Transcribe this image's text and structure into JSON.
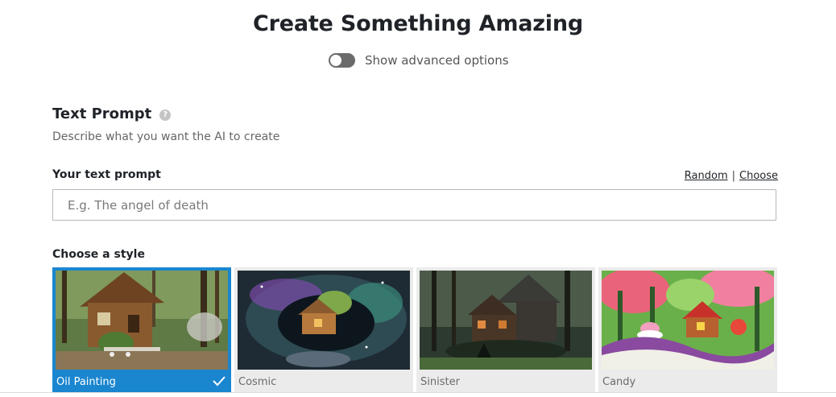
{
  "page": {
    "title": "Create Something Amazing",
    "advanced_toggle_label": "Show advanced options",
    "advanced_toggle_on": false
  },
  "text_prompt": {
    "heading": "Text Prompt",
    "help_icon": "question-icon",
    "description": "Describe what you want the AI to create",
    "field_label": "Your text prompt",
    "random_link": "Random",
    "separator": "|",
    "choose_link": "Choose",
    "placeholder": "E.g. The angel of death",
    "value": ""
  },
  "style": {
    "heading": "Choose a style",
    "selected": "Oil Painting",
    "options": [
      {
        "name": "Oil Painting"
      },
      {
        "name": "Cosmic"
      },
      {
        "name": "Sinister"
      },
      {
        "name": "Candy"
      }
    ]
  },
  "colors": {
    "accent": "#1a86cf",
    "title": "#1f2328",
    "muted": "#666666"
  }
}
